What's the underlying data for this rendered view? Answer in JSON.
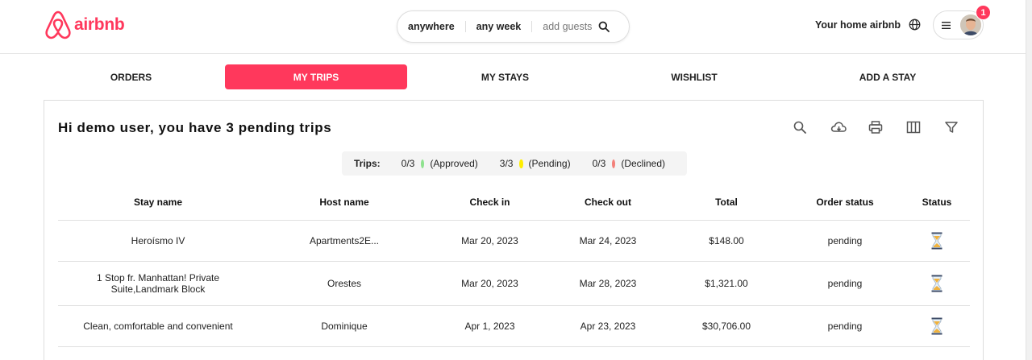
{
  "brand": {
    "name": "airbnb",
    "color": "#ff385c"
  },
  "search": {
    "location": "anywhere",
    "dates": "any week",
    "guests_placeholder": "add guests",
    "icon": "search-icon"
  },
  "header": {
    "host_link": "Your home airbnb",
    "globe_icon": "globe-icon",
    "menu_icon": "hamburger-icon",
    "notification_count": "1"
  },
  "tabs": [
    {
      "label": "ORDERS",
      "active": false
    },
    {
      "label": "MY TRIPS",
      "active": true
    },
    {
      "label": "MY STAYS",
      "active": false
    },
    {
      "label": "WISHLIST",
      "active": false
    },
    {
      "label": "ADD A STAY",
      "active": false
    }
  ],
  "card": {
    "title": "Hi demo user, you have 3 pending trips",
    "toolbar": [
      "search-icon",
      "cloud-download-icon",
      "print-icon",
      "columns-icon",
      "filter-icon"
    ]
  },
  "summary": {
    "label": "Trips:",
    "items": [
      {
        "count": "0/3",
        "status": "(Approved)",
        "color": "#8ee28e"
      },
      {
        "count": "3/3",
        "status": "(Pending)",
        "color": "#ffee00"
      },
      {
        "count": "0/3",
        "status": "(Declined)",
        "color": "#f38079"
      }
    ]
  },
  "table": {
    "columns": [
      "Stay name",
      "Host name",
      "Check in",
      "Check out",
      "Total",
      "Order status",
      "Status"
    ],
    "rows": [
      {
        "stay": "Heroísmo IV",
        "host": "Apartments2E...",
        "check_in": "Mar 20, 2023",
        "check_out": "Mar 24, 2023",
        "total": "$148.00",
        "order_status": "pending",
        "status_icon": "hourglass-icon"
      },
      {
        "stay": "1 Stop fr. Manhattan! Private Suite,Landmark Block",
        "host": "Orestes",
        "check_in": "Mar 20, 2023",
        "check_out": "Mar 28, 2023",
        "total": "$1,321.00",
        "order_status": "pending",
        "status_icon": "hourglass-icon"
      },
      {
        "stay": "Clean, comfortable and convenient",
        "host": "Dominique",
        "check_in": "Apr 1, 2023",
        "check_out": "Apr 23, 2023",
        "total": "$30,706.00",
        "order_status": "pending",
        "status_icon": "hourglass-icon"
      }
    ]
  }
}
